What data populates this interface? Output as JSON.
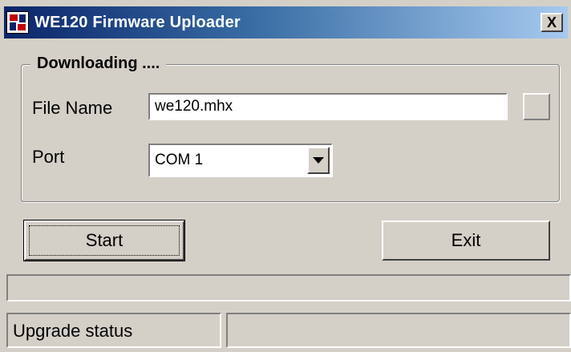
{
  "window": {
    "title": "WE120 Firmware Uploader",
    "close_glyph": "X",
    "icon": "app-icon"
  },
  "group": {
    "legend": "Downloading ...."
  },
  "file": {
    "label": "File Name",
    "value": "we120.mhx"
  },
  "port": {
    "label": "Port",
    "selected": "COM 1"
  },
  "buttons": {
    "start": "Start",
    "exit": "Exit"
  },
  "progress": {
    "percent": 0
  },
  "status": {
    "text": "Upgrade status",
    "detail": ""
  },
  "colors": {
    "titlebar_start": "#0a246a",
    "titlebar_end": "#a6caf0",
    "face": "#d4d0c8"
  }
}
